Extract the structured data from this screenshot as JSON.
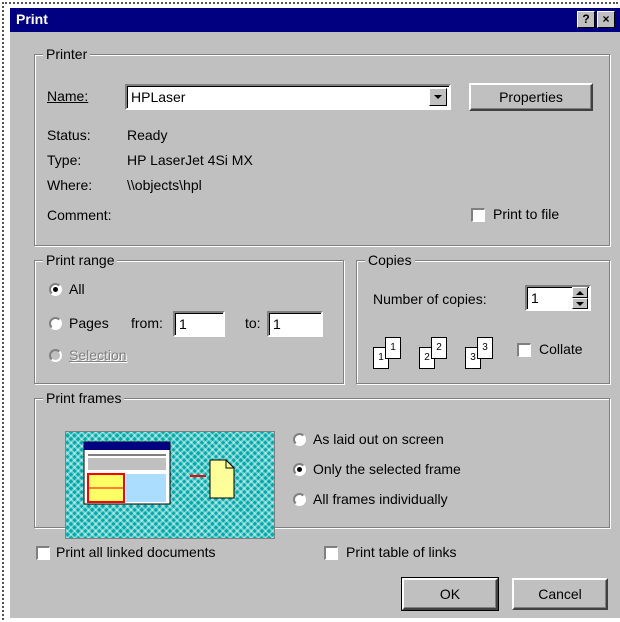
{
  "window": {
    "title": "Print",
    "help_glyph": "?",
    "close_glyph": "×"
  },
  "printer": {
    "group_label": "Printer",
    "name_label": "Name:",
    "name_value": "HPLaser",
    "properties_button": "Properties",
    "status_label": "Status:",
    "status_value": "Ready",
    "type_label": "Type:",
    "type_value": "HP LaserJet 4Si MX",
    "where_label": "Where:",
    "where_value": "\\\\objects\\hpl",
    "comment_label": "Comment:",
    "print_to_file_label": "Print to file"
  },
  "print_range": {
    "group_label": "Print range",
    "all_label": "All",
    "pages_label": "Pages",
    "from_label": "from:",
    "from_value": "1",
    "to_label": "to:",
    "to_value": "1",
    "selection_label": "Selection"
  },
  "copies": {
    "group_label": "Copies",
    "number_label": "Number of copies:",
    "number_value": "1",
    "collate_label": "Collate",
    "page_glyphs": [
      "1",
      "1",
      "2",
      "2",
      "3",
      "3"
    ]
  },
  "print_frames": {
    "group_label": "Print frames",
    "options": [
      "As laid out on screen",
      "Only the selected frame",
      "All frames individually"
    ],
    "selected_index": 1
  },
  "bottom": {
    "print_linked_label": "Print all linked documents",
    "print_table_label": "Print table of links",
    "ok_button": "OK",
    "cancel_button": "Cancel"
  },
  "colors": {
    "title_bar": "#000080",
    "face": "#c0c0c0",
    "preview_teal": "#00aaaa",
    "preview_yellow": "#ffff66",
    "preview_red": "#ff0000"
  }
}
